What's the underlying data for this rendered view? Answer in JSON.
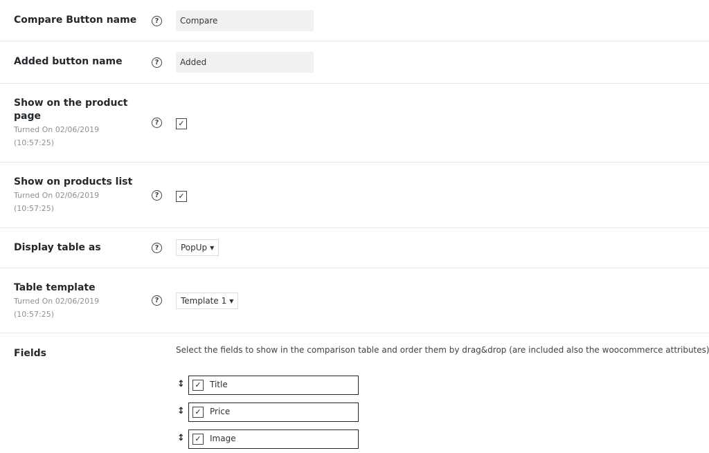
{
  "settings": {
    "compare_button": {
      "label": "Compare Button name",
      "value": "Compare"
    },
    "added_button": {
      "label": "Added button name",
      "value": "Added"
    },
    "show_product_page": {
      "label": "Show on the product page",
      "note": "Turned On 02/06/2019 (10:57:25)",
      "checked": true
    },
    "show_products_list": {
      "label": "Show on products list",
      "note": "Turned On 02/06/2019 (10:57:25)",
      "checked": true
    },
    "display_table_as": {
      "label": "Display table as",
      "selected": "PopUp"
    },
    "table_template": {
      "label": "Table template",
      "note": "Turned On 02/06/2019 (10:57:25)",
      "selected": "Template 1"
    },
    "fields": {
      "label": "Fields",
      "description": "Select the fields to show in the comparison table and order them by drag&drop (are included also the woocommerce attributes)",
      "items": [
        {
          "name": "Title",
          "checked": true
        },
        {
          "name": "Price",
          "checked": true
        },
        {
          "name": "Image",
          "checked": true
        }
      ]
    }
  },
  "icons": {
    "help": "help-icon",
    "drag": "drag-handle-icon",
    "check": "checkmark"
  },
  "colors": {
    "text": "#23282d",
    "muted": "#8c8f94",
    "input_bg": "#f1f1f1",
    "divider": "#e6e6e6"
  }
}
